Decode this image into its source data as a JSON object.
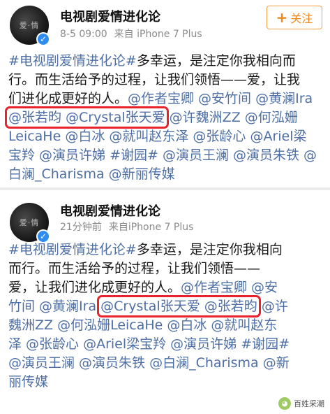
{
  "follow": {
    "label": "关注",
    "icon": "plus-icon"
  },
  "posts": [
    {
      "author": "电视剧爱情进化论",
      "avatar_text": "爱·情",
      "time": "8-5 09:00",
      "source": "来自 iPhone 7 Plus",
      "lines": [
        "#电视剧爱情进化论#多幸运，是注定你我相向而",
        "行。而生活给予的过程，让我们领悟——爱，让我",
        "们进化成更好的人。@作者宝卿 @安竹间 @黄澜Ira",
        [
          "@张若昀 @Crystal张天爱",
          " @许魏洲ZZ @何泓姗"
        ],
        "LeicaHe @白冰 @就叫赵东泽 @张龄心 @Ariel梁",
        "宝羚 @演员许娣 #谢园# @演员王澜 @演员朱铁 @",
        "白澜_Charisma @新丽传媒"
      ]
    },
    {
      "author": "电视剧爱情进化论",
      "avatar_text": "爱·情",
      "time": "21分钟前",
      "source": "来自iPhone 7 Plus",
      "lines": [
        "#电视剧爱情进化论#多幸运，是注定你我相向",
        "而行。而生活给予的过程，让我们领悟——",
        "爱，让我们进化成更好的人。@作者宝卿 @安",
        [
          "竹间 @黄澜Ira ",
          "@Crystal张天爱 @张若昀",
          " @许"
        ],
        "魏洲ZZ @何泓姗LeicaHe @白冰 @就叫赵东",
        "泽 @张龄心 @Ariel梁宝羚 @演员许娣 #谢园#",
        "@演员王澜 @演员朱铁 @白澜_Charisma @新",
        "丽传媒"
      ]
    }
  ],
  "watermark": {
    "text": "百姓采潮",
    "icon": "wechat-icon"
  },
  "colors": {
    "link": "#4e6fa5",
    "highlight_box": "#e8232c",
    "follow": "#f08a1e",
    "verified": "#2e8cf0"
  }
}
